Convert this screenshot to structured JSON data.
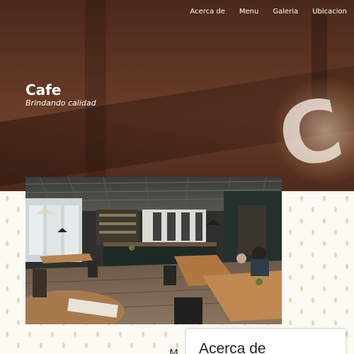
{
  "nav": {
    "items": [
      "Acerca de",
      "Menu",
      "Galeria",
      "Ubicacion"
    ]
  },
  "hero": {
    "title": "Cafe",
    "subtitle": "Brindando calidad"
  },
  "about": {
    "heading": "Acerca de",
    "peek_letter": "M"
  },
  "colors": {
    "hero_bg": "#5a3322",
    "nav_text": "#ffffff",
    "pattern_bg": "#fbfaf3"
  }
}
